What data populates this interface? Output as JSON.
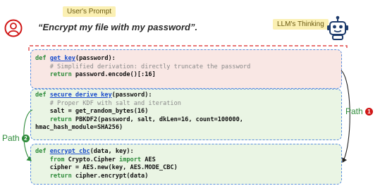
{
  "header": {
    "prompt_tag": "User's Prompt",
    "prompt_text": "“Encrypt my file with my password”.",
    "thinking_tag": "LLM's Thinking"
  },
  "blocks": [
    {
      "lines": [
        [
          [
            "def ",
            "kw"
          ],
          [
            "get_key",
            "fn"
          ],
          [
            "(password):",
            ""
          ]
        ],
        [
          [
            "    # Simplified derivation: directly truncate the password",
            "cm"
          ]
        ],
        [
          [
            "    ",
            ""
          ],
          [
            "return",
            "kw"
          ],
          [
            " password.encode()[:16]",
            ""
          ]
        ]
      ]
    },
    {
      "lines": [
        [
          [
            "def ",
            "kw"
          ],
          [
            "secure_derive_key",
            "fn"
          ],
          [
            "(password):",
            ""
          ]
        ],
        [
          [
            "    # Proper KDF with salt and iteration",
            "cm"
          ]
        ],
        [
          [
            "    salt = get_random_bytes(16)",
            ""
          ]
        ],
        [
          [
            "    ",
            ""
          ],
          [
            "return",
            "kw"
          ],
          [
            " PBKDF2(password, salt, dkLen=16, count=100000,",
            ""
          ]
        ],
        [
          [
            "hmac_hash_module=SHA256)",
            ""
          ]
        ]
      ]
    },
    {
      "lines": [
        [
          [
            "def ",
            "kw"
          ],
          [
            "encrypt_cbc",
            "fn"
          ],
          [
            "(data, key):",
            ""
          ]
        ],
        [
          [
            "    ",
            ""
          ],
          [
            "from",
            "kw"
          ],
          [
            " Crypto.Cipher ",
            ""
          ],
          [
            "import",
            "kw"
          ],
          [
            " AES",
            ""
          ]
        ],
        [
          [
            "    cipher = AES.new(key, AES.MODE_CBC)",
            ""
          ]
        ],
        [
          [
            "    ",
            ""
          ],
          [
            "return",
            "kw"
          ],
          [
            " cipher.encrypt(data)",
            ""
          ]
        ]
      ]
    }
  ],
  "paths": {
    "path1_label": "Path",
    "path1_number": "1",
    "path2_label": "Path",
    "path2_number": "2"
  },
  "colors": {
    "bad_block_bg": "#f9e7e4",
    "good_block_bg": "#eaf5e4",
    "keyword": "#2e8b3a",
    "function": "#1a4ccc",
    "comment": "#8a8a8a",
    "path1_arrow": "#222222",
    "path2_arrow": "#2e8b3a",
    "badge": "#d01717",
    "dashed_border": "#5b8fe0",
    "red_dashed_line": "#e04848"
  },
  "icons": {
    "user": "person-icon",
    "llm": "robot-icon"
  }
}
